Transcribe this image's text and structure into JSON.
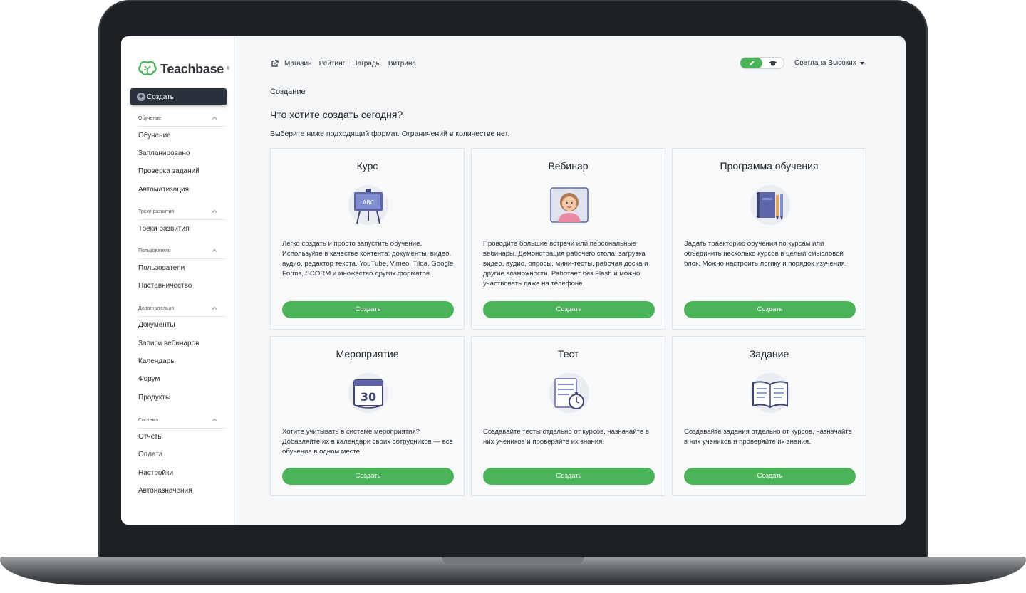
{
  "app": {
    "logo_text": "Teachbase",
    "logo_reg": "®",
    "brand_color": "#4bb358",
    "dark_button_color": "#2b313a"
  },
  "sidebar": {
    "create_label": "Создать",
    "sections": [
      {
        "title": "Обучение",
        "items": [
          "Обучение",
          "Запланировано",
          "Проверка заданий",
          "Автоматизация"
        ]
      },
      {
        "title": "Треки развития",
        "items": [
          "Треки развития"
        ]
      },
      {
        "title": "Пользователи",
        "items": [
          "Пользователи",
          "Наставничество"
        ]
      },
      {
        "title": "Дополнительно",
        "items": [
          "Документы",
          "Записи вебинаров",
          "Календарь",
          "Форум",
          "Продукты"
        ]
      },
      {
        "title": "Система",
        "items": [
          "Отчеты",
          "Оплата",
          "Настройки",
          "Автоназначения"
        ]
      }
    ]
  },
  "topnav": {
    "links": [
      "Магазин",
      "Рейтинг",
      "Награды",
      "Витрина"
    ],
    "user_name": "Светлана Высоких"
  },
  "main": {
    "breadcrumb": "Создание",
    "title": "Что хотите создать сегодня?",
    "subtitle": "Выберите ниже подходящий формат. Ограничений в количестве нет."
  },
  "cards": [
    {
      "title": "Курс",
      "icon": "chalkboard-abc-icon",
      "illus_text": "ABC",
      "desc": "Легко создать и просто запустить обучение. Используйте в качестве контента: документы, видео, аудио, редактор текста, YouTube, Vimeo, Tilda, Google Forms, SCORM и множество других форматов.",
      "button": "Создать"
    },
    {
      "title": "Вебинар",
      "icon": "webinar-presenter-icon",
      "desc": "Проводите большие встречи или персональные вебинары. Демонстрация рабочего стола, загрузка видео, аудио, опросы, мини-тесты, рабочая доска и другие возможности. Работает без Flash и можно участвовать даже на телефоне.",
      "button": "Создать"
    },
    {
      "title": "Программа обучения",
      "icon": "notebook-pencils-icon",
      "desc": "Задать траекторию обучения по курсам или объединить несколько курсов в целый смысловой блок. Можно настроить логику и порядок изучения.",
      "button": "Создать"
    },
    {
      "title": "Мероприятие",
      "icon": "calendar-30-icon",
      "illus_text": "30",
      "desc": "Хотите учитывать в системе мероприятия? Добавляйте их в календари своих сотрудников — всё обучение в одном месте.",
      "button": "Создать"
    },
    {
      "title": "Тест",
      "icon": "checklist-stopwatch-icon",
      "desc": "Создавайте тесты отдельно от курсов, назначайте в них учеников и проверяйте их знания.",
      "button": "Создать"
    },
    {
      "title": "Задание",
      "icon": "open-book-icon",
      "desc": "Создавайте задания отдельно от курсов, назначайте в них учеников и проверяйте их знания.",
      "button": "Создать"
    }
  ]
}
